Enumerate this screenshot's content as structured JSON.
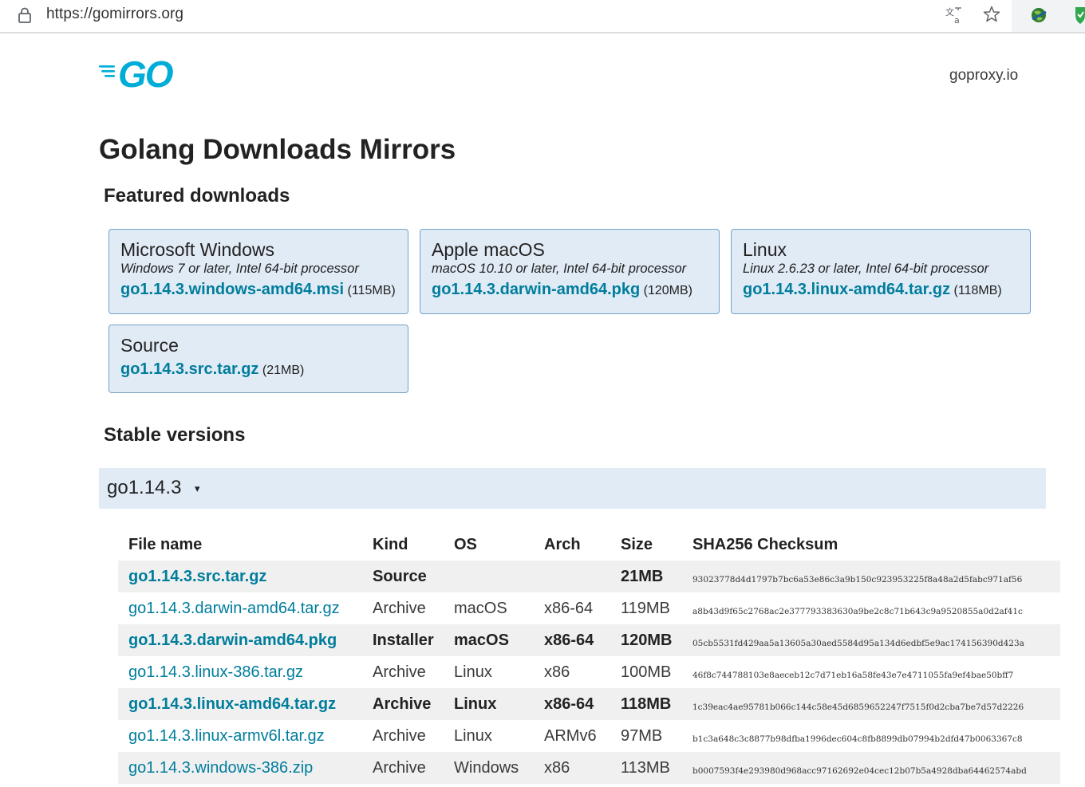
{
  "browser": {
    "url": "https://gomirrors.org",
    "icons": [
      "lock-icon",
      "translate-icon",
      "bookmark-star-icon",
      "extension-globe-icon",
      "extension-shield-icon"
    ]
  },
  "header": {
    "logo": "GO",
    "proxy_link": "goproxy.io"
  },
  "page_title": "Golang Downloads Mirrors",
  "featured": {
    "heading": "Featured downloads",
    "cards": [
      {
        "os": "Microsoft Windows",
        "desc": "Windows 7 or later, Intel 64-bit processor",
        "file": "go1.14.3.windows-amd64.msi",
        "size": "(115MB)"
      },
      {
        "os": "Apple macOS",
        "desc": "macOS 10.10 or later, Intel 64-bit processor",
        "file": "go1.14.3.darwin-amd64.pkg",
        "size": "(120MB)"
      },
      {
        "os": "Linux",
        "desc": "Linux 2.6.23 or later, Intel 64-bit processor",
        "file": "go1.14.3.linux-amd64.tar.gz",
        "size": "(118MB)"
      },
      {
        "os": "Source",
        "file": "go1.14.3.src.tar.gz",
        "size": "(21MB)"
      }
    ]
  },
  "stable": {
    "heading": "Stable versions",
    "version": "go1.14.3",
    "caret": "▾",
    "columns": [
      "File name",
      "Kind",
      "OS",
      "Arch",
      "Size",
      "SHA256 Checksum"
    ],
    "rows": [
      {
        "file": "go1.14.3.src.tar.gz",
        "kind": "Source",
        "os": "",
        "arch": "",
        "size": "21MB",
        "sha": "93023778d4d1797b7bc6a53e86c3a9b150c923953225f8a48a2d5fabc971af56"
      },
      {
        "file": "go1.14.3.darwin-amd64.tar.gz",
        "kind": "Archive",
        "os": "macOS",
        "arch": "x86-64",
        "size": "119MB",
        "sha": "a8b43d9f65c2768ac2e377793383630a9be2c8c71b643c9a9520855a0d2af41c"
      },
      {
        "file": "go1.14.3.darwin-amd64.pkg",
        "kind": "Installer",
        "os": "macOS",
        "arch": "x86-64",
        "size": "120MB",
        "sha": "05cb5531fd429aa5a13605a30aed5584d95a134d6edbf5e9ac174156390d423a"
      },
      {
        "file": "go1.14.3.linux-386.tar.gz",
        "kind": "Archive",
        "os": "Linux",
        "arch": "x86",
        "size": "100MB",
        "sha": "46f8c744788103e8aeceb12c7d71eb16a58fe43e7e4711055fa9ef4bae50bff7"
      },
      {
        "file": "go1.14.3.linux-amd64.tar.gz",
        "kind": "Archive",
        "os": "Linux",
        "arch": "x86-64",
        "size": "118MB",
        "sha": "1c39eac4ae95781b066c144c58e45d6859652247f7515f0d2cba7be7d57d2226"
      },
      {
        "file": "go1.14.3.linux-armv6l.tar.gz",
        "kind": "Archive",
        "os": "Linux",
        "arch": "ARMv6",
        "size": "97MB",
        "sha": "b1c3a648c3c8877b98dfba1996dec604c8fb8899db07994b2dfd47b0063367c8"
      },
      {
        "file": "go1.14.3.windows-386.zip",
        "kind": "Archive",
        "os": "Windows",
        "arch": "x86",
        "size": "113MB",
        "sha": "b0007593f4e293980d968acc97162692e04cec12b07b5a4928dba64462574abd"
      }
    ]
  },
  "colors": {
    "link": "#007d9c",
    "card_bg": "#e0ebf5",
    "card_border": "#73a2ca",
    "go_logo": "#00add8",
    "row_alt": "#f0f0f0"
  }
}
